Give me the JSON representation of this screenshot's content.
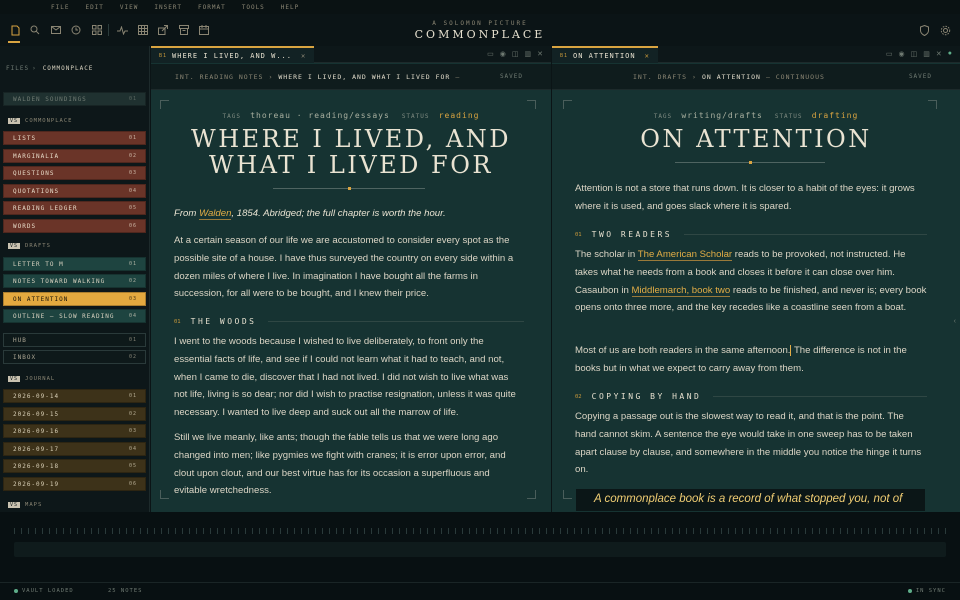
{
  "menu": [
    "FILE",
    "EDIT",
    "VIEW",
    "INSERT",
    "FORMAT",
    "TOOLS",
    "HELP"
  ],
  "brand": {
    "subtitle": "A SOLOMON PICTURE",
    "title": "COMMONPLACE"
  },
  "toolbar_icons": [
    "file-icon",
    "search-icon",
    "mail-icon",
    "history-icon",
    "grid-icon",
    "pulse-icon",
    "table-icon",
    "export-icon",
    "archive-icon",
    "calendar-icon"
  ],
  "sidebar": {
    "files_label": "FILES",
    "root": "COMMONPLACE",
    "top_item": {
      "label": "WALDEN SOUNDINGS",
      "n": "01"
    },
    "sections": [
      {
        "vs": "VS",
        "label": "COMMONPLACE"
      },
      {
        "vs": "VS",
        "label": "DRAFTS"
      },
      {
        "vs": "VS",
        "label": "JOURNAL"
      },
      {
        "vs": "VS",
        "label": "MAPS"
      }
    ],
    "commonplace": [
      {
        "label": "LISTS",
        "n": "01"
      },
      {
        "label": "MARGINALIA",
        "n": "02"
      },
      {
        "label": "QUESTIONS",
        "n": "03"
      },
      {
        "label": "QUOTATIONS",
        "n": "04"
      },
      {
        "label": "READING LEDGER",
        "n": "05"
      },
      {
        "label": "WORDS",
        "n": "06"
      }
    ],
    "drafts": [
      {
        "label": "LETTER TO M",
        "n": "01"
      },
      {
        "label": "NOTES TOWARD WALKING",
        "n": "02"
      },
      {
        "label": "ON ATTENTION",
        "n": "03"
      },
      {
        "label": "OUTLINE — SLOW READING",
        "n": "04"
      }
    ],
    "misc": [
      {
        "label": "HUB",
        "n": "01"
      },
      {
        "label": "INBOX",
        "n": "02"
      }
    ],
    "journal": [
      {
        "label": "2026-09-14",
        "n": "01"
      },
      {
        "label": "2026-09-15",
        "n": "02"
      },
      {
        "label": "2026-09-16",
        "n": "03"
      },
      {
        "label": "2026-09-17",
        "n": "04"
      },
      {
        "label": "2026-09-18",
        "n": "05"
      },
      {
        "label": "2026-09-19",
        "n": "06"
      }
    ]
  },
  "left": {
    "tab": {
      "buffer": "B1",
      "label": "WHERE I LIVED, AND W..."
    },
    "crumb": {
      "scene": "INT. READING NOTES",
      "sep": "—",
      "current": "WHERE I LIVED, AND WHAT I LIVED FOR",
      "trail": "—",
      "saved": "SAVED"
    },
    "meta": {
      "tags_label": "TAGS",
      "tags": "thoreau · reading/essays",
      "status_label": "STATUS",
      "status": "reading"
    },
    "title_line1": "WHERE I LIVED, AND",
    "title_line2": "WHAT I LIVED FOR",
    "intro_pre": "From ",
    "intro_link": "Walden",
    "intro_post": ", 1854. Abridged; the full chapter is worth the hour.",
    "p1": "At a certain season of our life we are accustomed to consider every spot as the possible site of a house. I have thus surveyed the country on every side within a dozen miles of where I live. In imagination I have bought all the farms in succession, for all were to be bought, and I knew their price.",
    "h1": {
      "n": "01",
      "label": "THE WOODS"
    },
    "p2": "I went to the woods because I wished to live deliberately, to front only the essential facts of life, and see if I could not learn what it had to teach, and not, when I came to die, discover that I had not lived. I did not wish to live what was not life, living is so dear; nor did I wish to practise resignation, unless it was quite necessary. I wanted to live deep and suck out all the marrow of life.",
    "p3": "Still we live meanly, like ants; though the fable tells us that we were long ago changed into men; like pygmies we fight with cranes; it is error upon error, and clout upon clout, and our best virtue has for its occasion a superfluous and evitable wretchedness."
  },
  "right": {
    "tab": {
      "buffer": "B1",
      "label": "ON ATTENTION"
    },
    "crumb": {
      "scene": "INT. DRAFTS",
      "sep": "—",
      "current": "ON ATTENTION",
      "trail": "— CONTINUOUS",
      "saved": "SAVED"
    },
    "meta": {
      "tags_label": "TAGS",
      "tags": "writing/drafts",
      "status_label": "STATUS",
      "status": "drafting"
    },
    "title": "ON ATTENTION",
    "p1": "Attention is not a store that runs down. It is closer to a habit of the eyes: it grows where it is used, and goes slack where it is spared.",
    "h1": {
      "n": "01",
      "label": "TWO READERS"
    },
    "p2_a": "The scholar in ",
    "p2_link1": "The American Scholar",
    "p2_b": " reads to be provoked, not instructed. He takes what he needs from a book and closes it before it can close over him. Casaubon in ",
    "p2_link2": "Middlemarch, book two",
    "p2_c": " reads to be finished, and never is; every book opens onto three more, and the key recedes like a coastline seen from a boat.",
    "p3_a": "Most of us are both readers in the same afternoon.",
    "p3_b": " The difference is not in the books but in what we expect to carry away from them.",
    "h2": {
      "n": "02",
      "label": "COPYING BY HAND"
    },
    "p4": "Copying a passage out is the slowest way to read it, and that is the point. The hand cannot skim. A sentence the eye would take in one sweep has to be taken apart clause by clause, and somewhere in the middle you notice the hinge it turns on.",
    "quote": "A commonplace book is a record of what stopped you, not of"
  },
  "status": {
    "left": "VAULT LOADED",
    "notes": "25 NOTES",
    "right": "IN SYNC"
  },
  "colors": {
    "accent": "#d9a441",
    "panel": "#163332",
    "link": "#e2ad46"
  }
}
